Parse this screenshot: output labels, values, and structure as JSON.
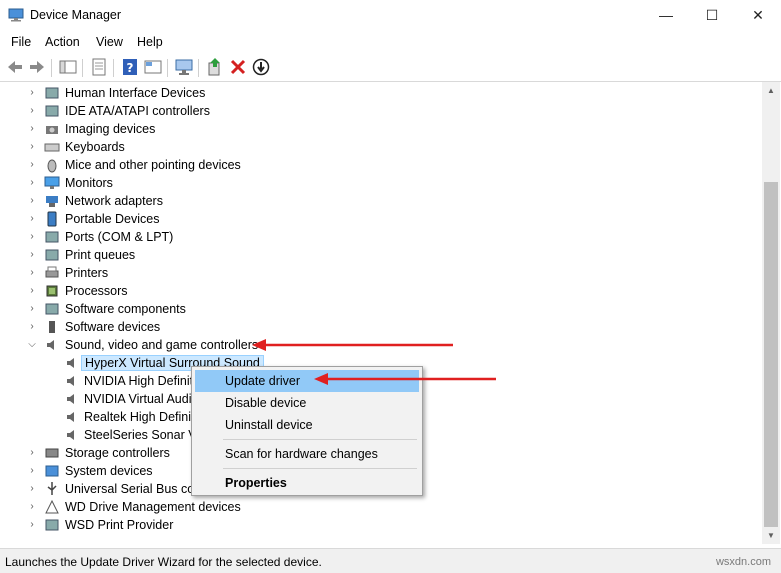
{
  "window": {
    "title": "Device Manager",
    "minimize": "—",
    "maximize": "☐",
    "close": "✕"
  },
  "menu": [
    "File",
    "Action",
    "View",
    "Help"
  ],
  "tree": [
    {
      "label": "Human Interface Devices",
      "icon": "hid-icon",
      "expanded": false
    },
    {
      "label": "IDE ATA/ATAPI controllers",
      "icon": "ide-controller-icon",
      "expanded": false
    },
    {
      "label": "Imaging devices",
      "icon": "camera-icon",
      "expanded": false
    },
    {
      "label": "Keyboards",
      "icon": "keyboard-icon",
      "expanded": false
    },
    {
      "label": "Mice and other pointing devices",
      "icon": "mouse-icon",
      "expanded": false
    },
    {
      "label": "Monitors",
      "icon": "monitor-icon",
      "expanded": false
    },
    {
      "label": "Network adapters",
      "icon": "network-icon",
      "expanded": false
    },
    {
      "label": "Portable Devices",
      "icon": "portable-device-icon",
      "expanded": false
    },
    {
      "label": "Ports (COM & LPT)",
      "icon": "port-icon",
      "expanded": false
    },
    {
      "label": "Print queues",
      "icon": "print-queue-icon",
      "expanded": false
    },
    {
      "label": "Printers",
      "icon": "printer-icon",
      "expanded": false
    },
    {
      "label": "Processors",
      "icon": "processor-icon",
      "expanded": false
    },
    {
      "label": "Software components",
      "icon": "software-component-icon",
      "expanded": false
    },
    {
      "label": "Software devices",
      "icon": "software-device-icon",
      "expanded": false
    },
    {
      "label": "Sound, video and game controllers",
      "icon": "speaker-icon",
      "expanded": true
    },
    {
      "label": "HyperX Virtual Surround Sound",
      "icon": "speaker-icon",
      "child": true,
      "selected": true
    },
    {
      "label": "NVIDIA High Definit",
      "icon": "speaker-icon",
      "child": true
    },
    {
      "label": "NVIDIA Virtual Audic",
      "icon": "speaker-icon",
      "child": true
    },
    {
      "label": "Realtek High Definit",
      "icon": "speaker-icon",
      "child": true
    },
    {
      "label": "SteelSeries Sonar Vir",
      "icon": "speaker-icon",
      "child": true
    },
    {
      "label": "Storage controllers",
      "icon": "storage-icon",
      "expanded": false
    },
    {
      "label": "System devices",
      "icon": "system-icon",
      "expanded": false
    },
    {
      "label": "Universal Serial Bus cont",
      "icon": "usb-icon",
      "expanded": false
    },
    {
      "label": "WD Drive Management devices",
      "icon": "wd-drive-icon",
      "expanded": false
    },
    {
      "label": "WSD Print Provider",
      "icon": "wsd-printer-icon",
      "expanded": false
    }
  ],
  "context_menu": {
    "update_driver": "Update driver",
    "disable_device": "Disable device",
    "uninstall_device": "Uninstall device",
    "scan": "Scan for hardware changes",
    "properties": "Properties"
  },
  "status": {
    "text": "Launches the Update Driver Wizard for the selected device.",
    "watermark": "wsxdn.com"
  },
  "colors": {
    "selection": "#cce8ff",
    "menu_highlight": "#91c9f7",
    "annotation_arrow": "#e02020"
  }
}
